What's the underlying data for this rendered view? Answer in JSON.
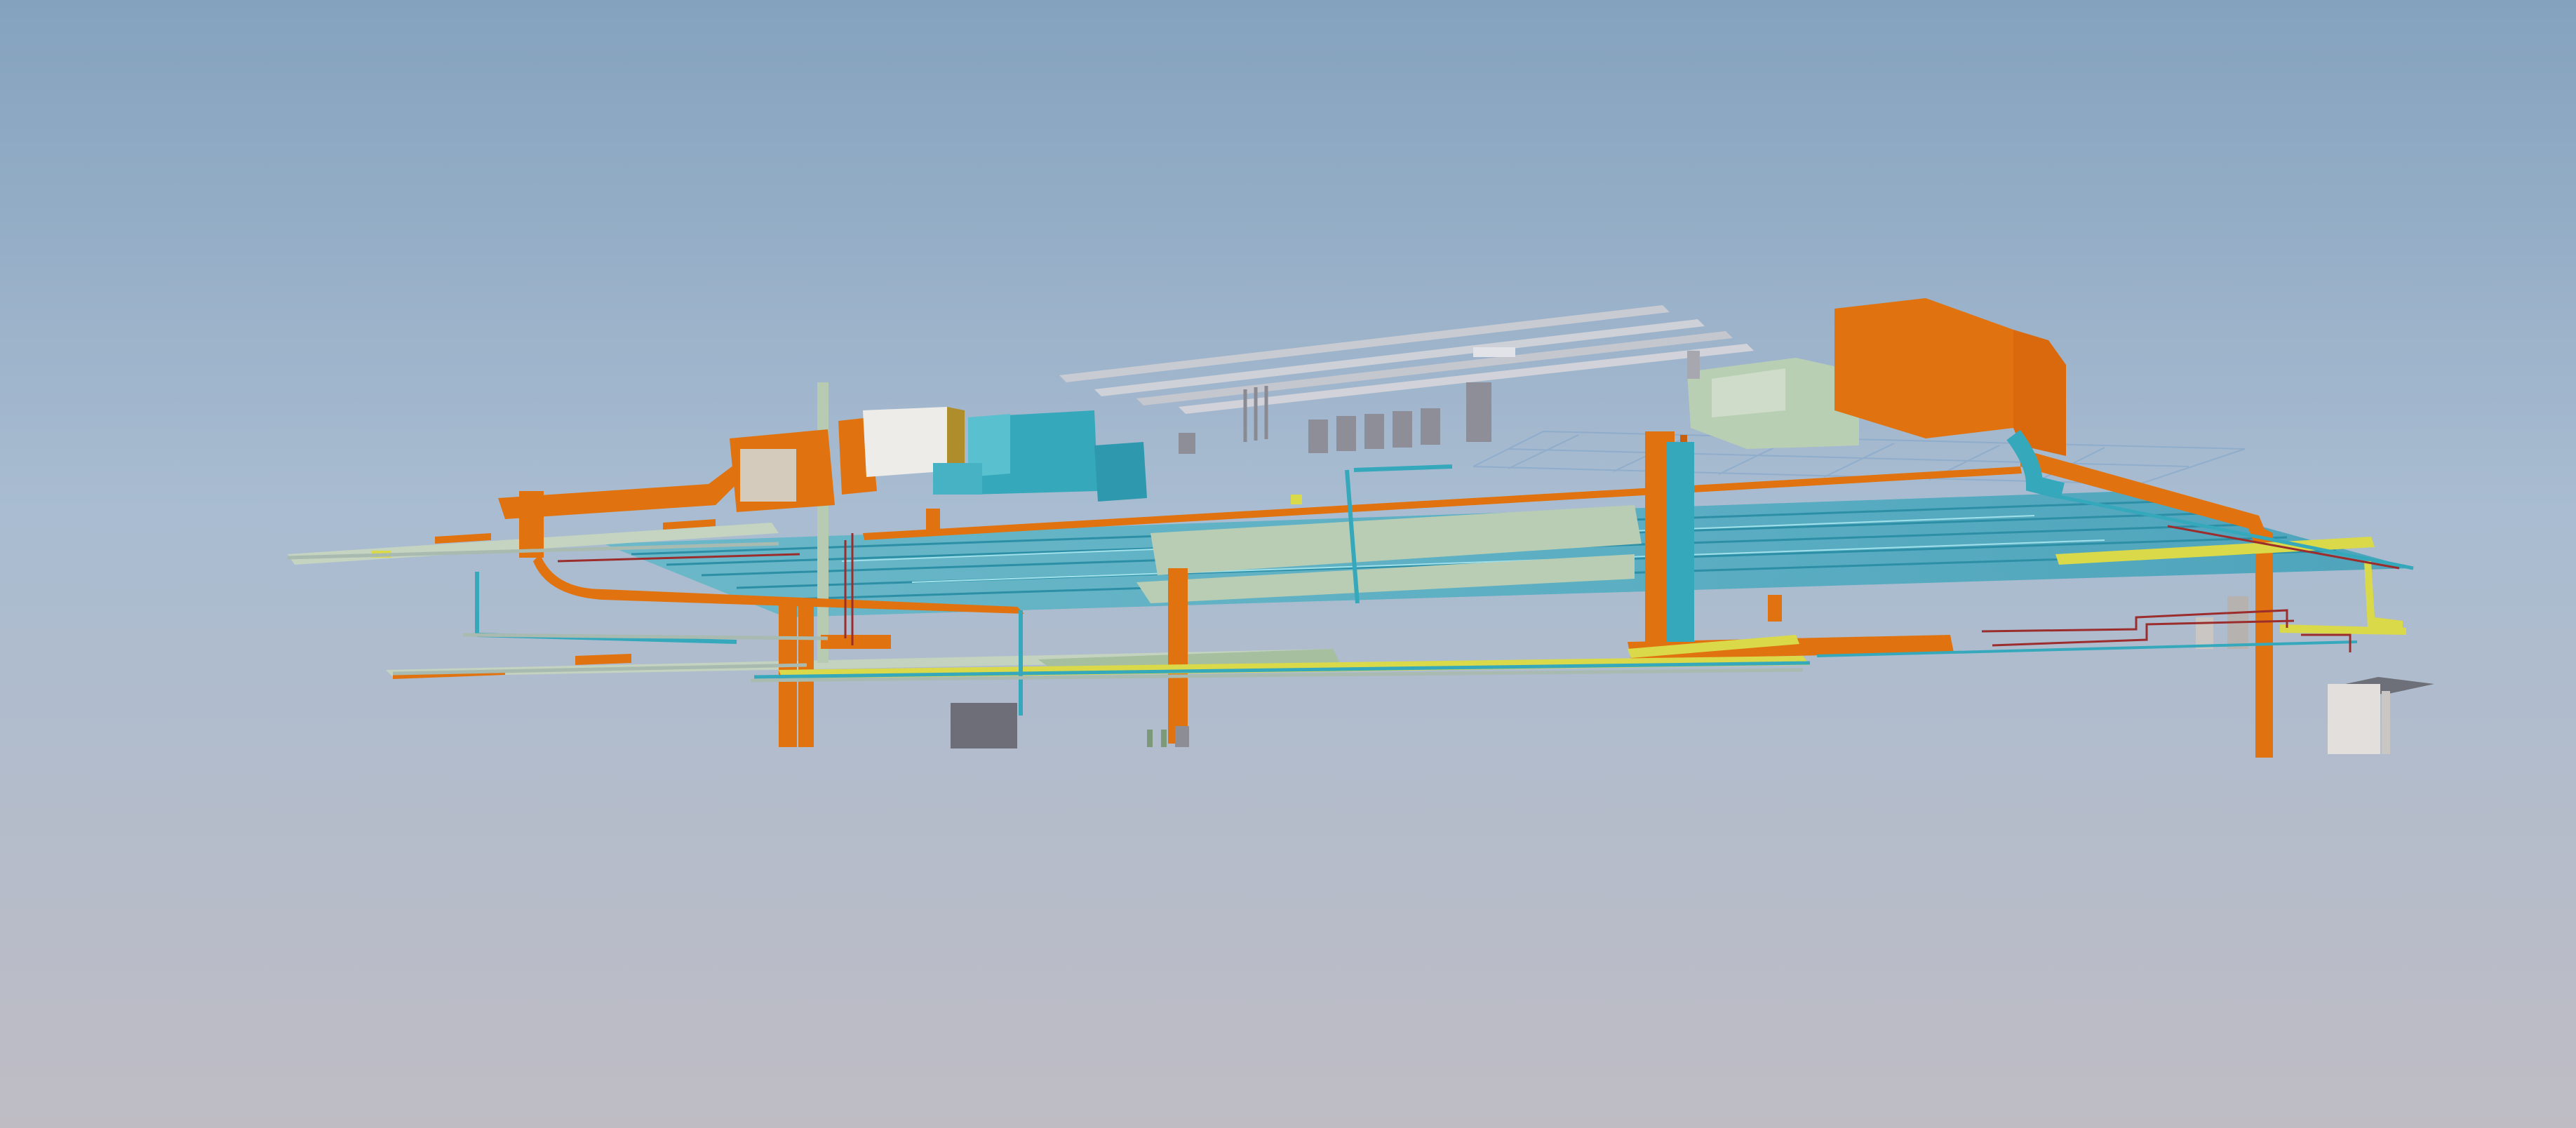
{
  "viewer": {
    "background_top": "#84a2be",
    "background_mid": "#a9bcd1",
    "background_bottom": "#bfbcc4"
  },
  "systems": {
    "supply_air_duct": "#e0730f",
    "chilled_water_pipe": "#36a8bb",
    "return_air_duct": "#b8cdb4",
    "cable_tray": "#d9d94a",
    "sanitary_pipe": "#9b2d2d",
    "lighting_fixture": "#c9cbd3",
    "equipment_grey": "#8d8d95",
    "equipment_light": "#e8e6e4"
  }
}
